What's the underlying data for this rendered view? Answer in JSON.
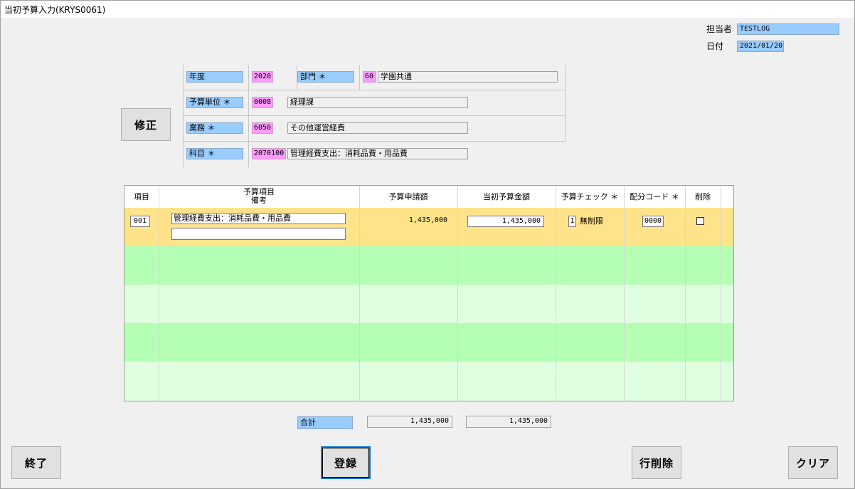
{
  "window": {
    "title": "当初予算入力(KRYS0061)"
  },
  "user": {
    "owner_label": "担当者",
    "owner_value": "TESTLOG",
    "date_label": "日付",
    "date_value": "2021/01/20"
  },
  "buttons": {
    "modify": "修正",
    "exit": "終了",
    "register": "登録",
    "delete_row": "行削除",
    "clear": "クリア"
  },
  "criteria": {
    "year_label": "年度",
    "year_value": "2020",
    "dept_label": "部門 ＊",
    "dept_code": "60",
    "dept_name": "学園共通",
    "unit_label": "予算単位 ＊",
    "unit_code": "0008",
    "unit_name": "経理課",
    "task_label": "業務 ＊",
    "task_code": "6050",
    "task_name": "その他運営経費",
    "subject_label": "科目 ＊",
    "subject_code": "2070100",
    "subject_name": "管理経費支出：消耗品費・用品費"
  },
  "grid": {
    "headers": {
      "item": "項目",
      "budget_item": "予算項目",
      "remarks": "備考",
      "request_amount": "予算申請額",
      "initial_amount": "当初予算金額",
      "budget_check": "予算チェック ＊",
      "alloc_code": "配分コード ＊",
      "delete": "削除"
    },
    "rows": [
      {
        "item_no": "001",
        "budget_item": "管理経費支出：消耗品費・用品費",
        "remarks": "",
        "request_amount": "1,435,000",
        "initial_amount": "1,435,000",
        "check_code": "1",
        "check_label": "無制限",
        "alloc_code": "0000",
        "delete_checked": false
      }
    ],
    "row_colors": [
      "#ffe38a",
      "#b4ffb4",
      "#e0ffe0",
      "#b4ffb4",
      "#e0ffe0"
    ]
  },
  "totals": {
    "label": "合計",
    "request_total": "1,435,000",
    "initial_total": "1,435,000"
  }
}
